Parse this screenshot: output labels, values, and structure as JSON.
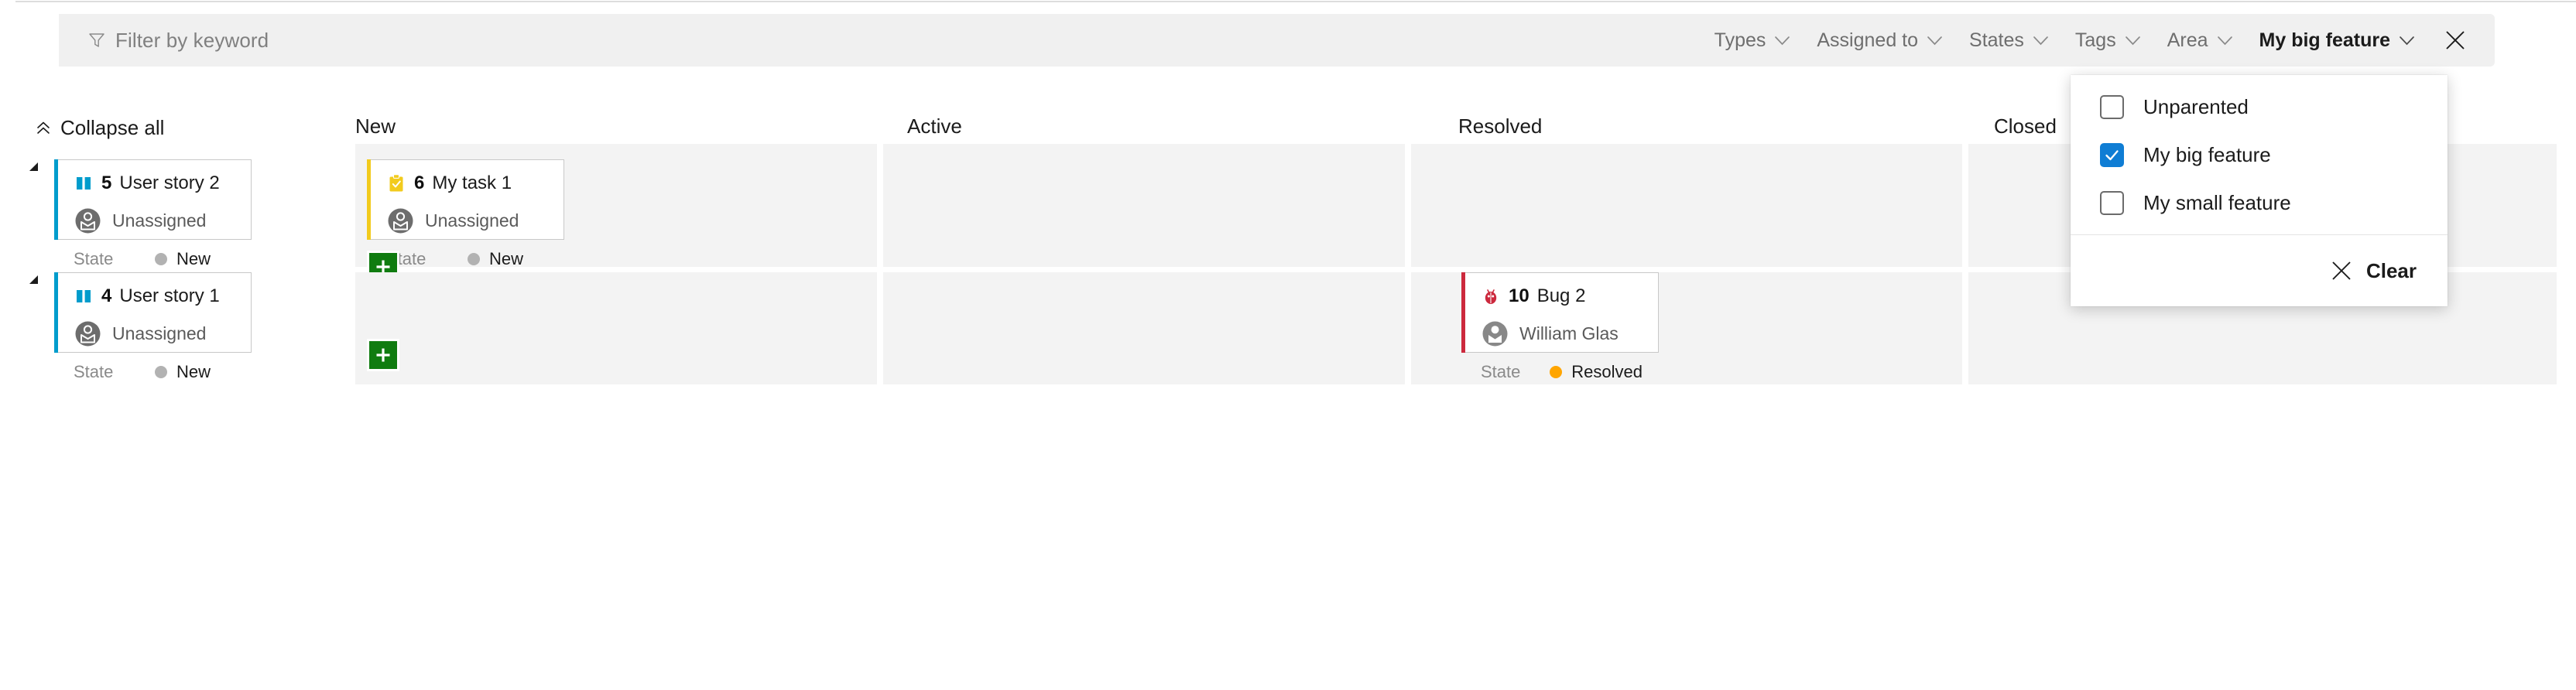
{
  "filter_bar": {
    "keyword_placeholder": "Filter by keyword",
    "funnel_icon": "funnel-icon",
    "close_icon": "close-icon",
    "pills": [
      {
        "label": "Types",
        "active": false,
        "icon": "chevron-down-icon"
      },
      {
        "label": "Assigned to",
        "active": false,
        "icon": "chevron-down-icon"
      },
      {
        "label": "States",
        "active": false,
        "icon": "chevron-down-icon"
      },
      {
        "label": "Tags",
        "active": false,
        "icon": "chevron-down-icon"
      },
      {
        "label": "Area",
        "active": false,
        "icon": "chevron-down-icon"
      },
      {
        "label": "My big feature",
        "active": true,
        "icon": "chevron-down-icon"
      }
    ]
  },
  "dropdown": {
    "open_for": "My big feature",
    "options": [
      {
        "label": "Unparented",
        "checked": false
      },
      {
        "label": "My big feature",
        "checked": true
      },
      {
        "label": "My small feature",
        "checked": false
      }
    ],
    "clear_label": "Clear",
    "clear_icon": "close-icon",
    "checked_color": "#0f7dd4"
  },
  "board": {
    "collapse_all_label": "Collapse all",
    "collapse_all_icon": "double-chevron-up-icon",
    "columns": [
      {
        "label": "New"
      },
      {
        "label": "Active"
      },
      {
        "label": "Resolved"
      },
      {
        "label": "Closed"
      }
    ],
    "add_button_label": "+",
    "add_button_color": "#107c10",
    "swimlanes": [
      {
        "parent": {
          "id": "5",
          "title": "User story 2",
          "type_icon": "user-story-icon",
          "stripe_color": "#009ccc",
          "assignee": "Unassigned",
          "assigned": false,
          "state_label": "State",
          "state_value": "New",
          "state_dot_color": "#b2b2b2"
        },
        "cards": [
          {
            "column": "New",
            "id": "6",
            "title": "My task 1",
            "type_icon": "task-icon",
            "stripe_color": "#f2cb1d",
            "assignee": "Unassigned",
            "assigned": false,
            "state_label": "State",
            "state_value": "New",
            "state_dot_color": "#b2b2b2"
          }
        ]
      },
      {
        "parent": {
          "id": "4",
          "title": "User story 1",
          "type_icon": "user-story-icon",
          "stripe_color": "#009ccc",
          "assignee": "Unassigned",
          "assigned": false,
          "state_label": "State",
          "state_value": "New",
          "state_dot_color": "#b2b2b2"
        },
        "cards": [
          {
            "column": "Resolved",
            "id": "10",
            "title": "Bug 2",
            "type_icon": "bug-icon",
            "stripe_color": "#cc293d",
            "assignee": "William Glas",
            "assigned": true,
            "state_label": "State",
            "state_value": "Resolved",
            "state_dot_color": "#ffa500"
          }
        ]
      }
    ]
  }
}
